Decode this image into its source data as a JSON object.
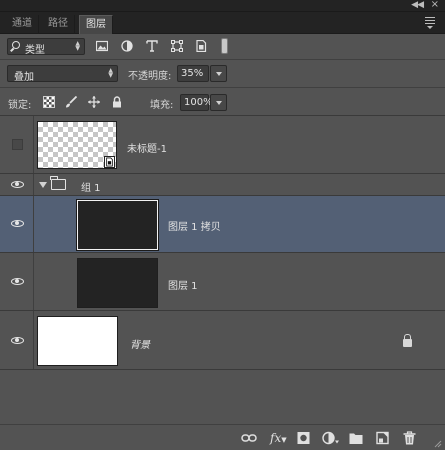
{
  "tabs": [
    {
      "label": "通道",
      "active": false
    },
    {
      "label": "路径",
      "active": false
    },
    {
      "label": "图层",
      "active": true
    }
  ],
  "filter": {
    "kind_label": "类型",
    "icons": [
      "image-filter-icon",
      "adjustment-filter-icon",
      "type-filter-icon",
      "shape-filter-icon",
      "smart-object-filter-icon"
    ]
  },
  "blend": {
    "mode": "叠加",
    "opacity_label": "不透明度:",
    "opacity_value": "35%"
  },
  "lock": {
    "label": "锁定:",
    "fill_label": "填充:",
    "fill_value": "100%"
  },
  "layers": [
    {
      "name": "未标题-1",
      "visible": false,
      "thumb": "transparent",
      "smart_object": true
    },
    {
      "name": "组 1",
      "visible": true,
      "type": "group",
      "expanded": true
    },
    {
      "name": "图层 1 拷贝",
      "visible": true,
      "thumb": "dark",
      "selected": true
    },
    {
      "name": "图层 1",
      "visible": true,
      "thumb": "dark"
    },
    {
      "name": "背景",
      "visible": true,
      "thumb": "white",
      "locked": true
    }
  ],
  "footer": {
    "fx_label": "fx"
  }
}
